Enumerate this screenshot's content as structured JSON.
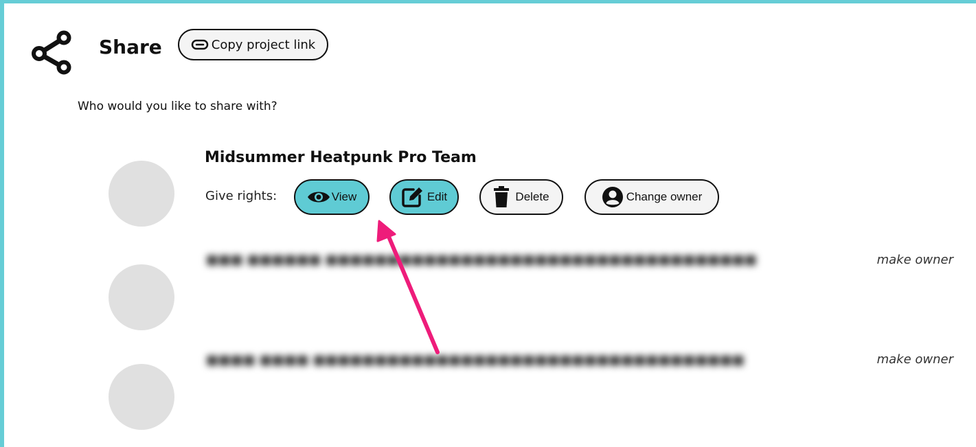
{
  "header": {
    "title": "Share",
    "copy_link_label": "Copy project link",
    "share_icon": "share-icon",
    "link_icon": "link-icon"
  },
  "prompt": "Who would you like to share with?",
  "team": {
    "name": "Midsummer Heatpunk Pro Team",
    "rights_label": "Give rights:",
    "buttons": [
      {
        "label": "View",
        "icon": "eye-icon",
        "active": true
      },
      {
        "label": "Edit",
        "icon": "edit-icon",
        "active": true
      },
      {
        "label": "Delete",
        "icon": "trash-icon",
        "active": false
      },
      {
        "label": "Change owner",
        "icon": "user-circle-icon",
        "active": false
      }
    ]
  },
  "members": [
    {
      "make_owner_label": "make owner"
    },
    {
      "make_owner_label": "make owner"
    }
  ],
  "colors": {
    "accent": "#5fcbd4",
    "border": "#66cdd6",
    "avatar": "#e0e0e0",
    "annotation_arrow": "#ee1c7a"
  }
}
